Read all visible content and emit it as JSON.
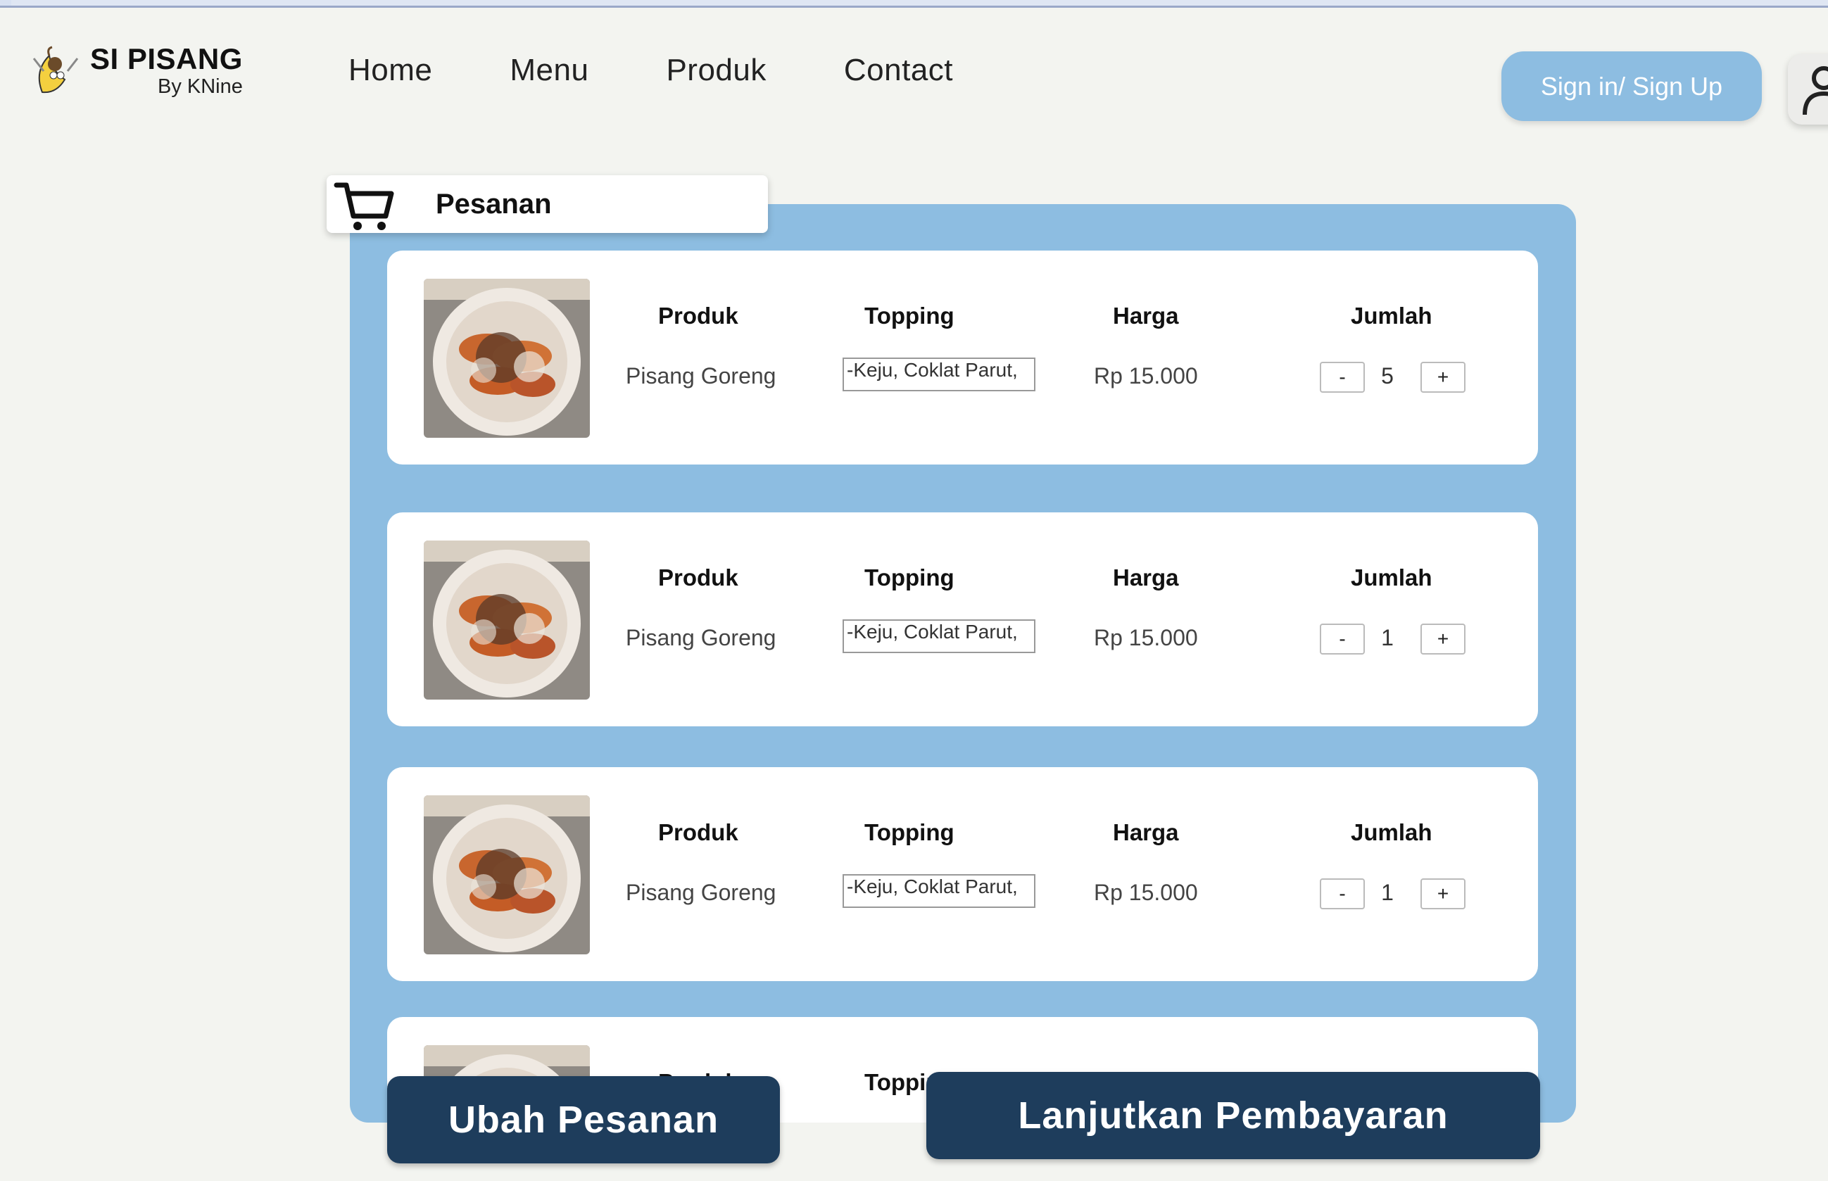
{
  "brand": {
    "title": "SI PISANG",
    "subtitle": "By KNine"
  },
  "nav": {
    "items": [
      "Home",
      "Menu",
      "Produk",
      "Contact"
    ]
  },
  "auth": {
    "signin_label": "Sign in/ Sign Up"
  },
  "cart": {
    "tab_label": "Pesanan",
    "columns": {
      "product": "Produk",
      "topping": "Topping",
      "price": "Harga",
      "qty": "Jumlah"
    },
    "items": [
      {
        "product": "Pisang Goreng",
        "topping": "-Keju, Coklat Parut,",
        "price": "Rp 15.000",
        "qty": "5",
        "minus": "-",
        "plus": "+"
      },
      {
        "product": "Pisang Goreng",
        "topping": "-Keju, Coklat Parut,",
        "price": "Rp 15.000",
        "qty": "1",
        "minus": "-",
        "plus": "+"
      },
      {
        "product": "Pisang Goreng",
        "topping": "-Keju, Coklat Parut,",
        "price": "Rp 15.000",
        "qty": "1",
        "minus": "-",
        "plus": "+"
      },
      {
        "product": "Produk",
        "topping": "Topping"
      }
    ]
  },
  "actions": {
    "edit_label": "Ubah Pesanan",
    "pay_label": "Lanjutkan Pembayaran"
  },
  "colors": {
    "accent": "#8dbde1",
    "dark": "#1e3d5c",
    "background": "#f3f4f0"
  },
  "icons": {
    "cart": "cart-icon",
    "user": "user-icon",
    "logo": "banana-logo"
  }
}
